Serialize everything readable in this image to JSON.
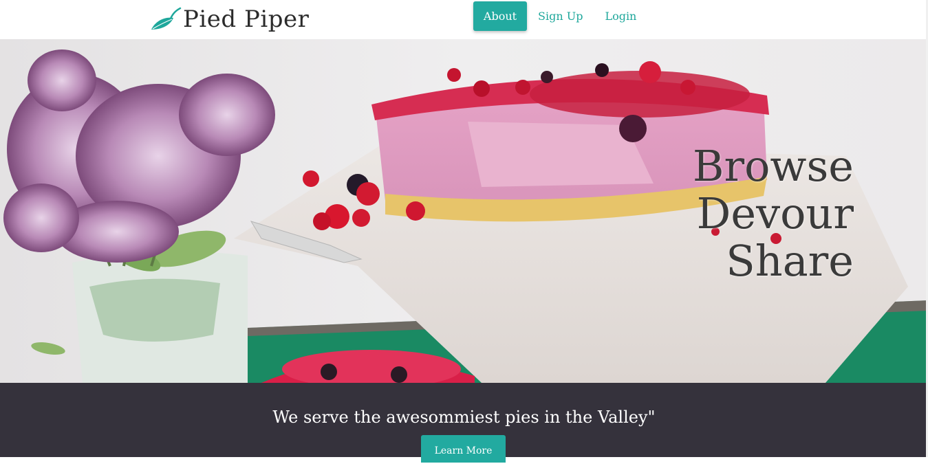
{
  "brand": {
    "name": "Pied Piper",
    "logo_icon": "leaf-icon",
    "color": "#1ea79b"
  },
  "nav": {
    "items": [
      {
        "label": "About",
        "active": true
      },
      {
        "label": "Sign Up",
        "active": false
      },
      {
        "label": "Login",
        "active": false
      }
    ]
  },
  "hero": {
    "taglines": [
      "Browse",
      "Devour",
      "Share"
    ],
    "image": "berry-cheesecake-with-lilac-flowers"
  },
  "band": {
    "quote": "We serve the awesommiest pies in the Valley\"",
    "button_label": "Learn More",
    "background": "#35323c",
    "accent": "#22aaa0"
  }
}
